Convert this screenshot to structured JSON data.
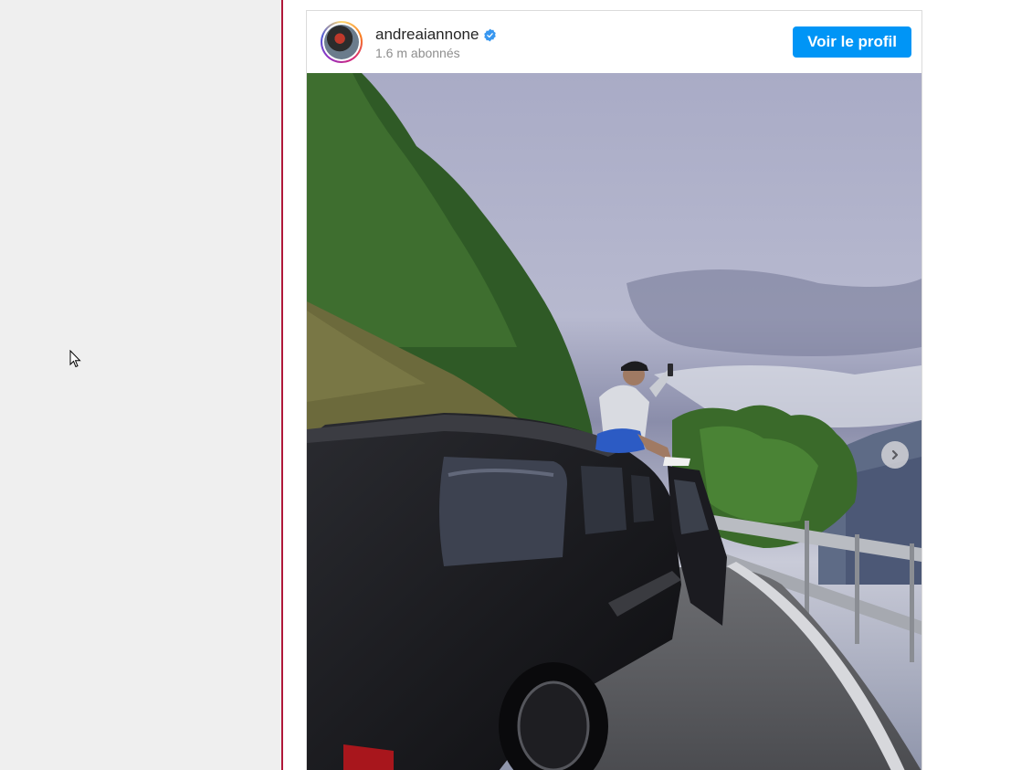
{
  "post": {
    "username": "andreaiannone",
    "followers": "1.6 m abonnés",
    "profile_button": "Voir le profil"
  },
  "icons": {
    "verified": "verified-badge-icon",
    "next": "chevron-right-icon",
    "cursor": "mouse-pointer-icon"
  },
  "colors": {
    "accent": "#0095f6",
    "divider": "#b0183a",
    "left_panel": "#efefef"
  }
}
